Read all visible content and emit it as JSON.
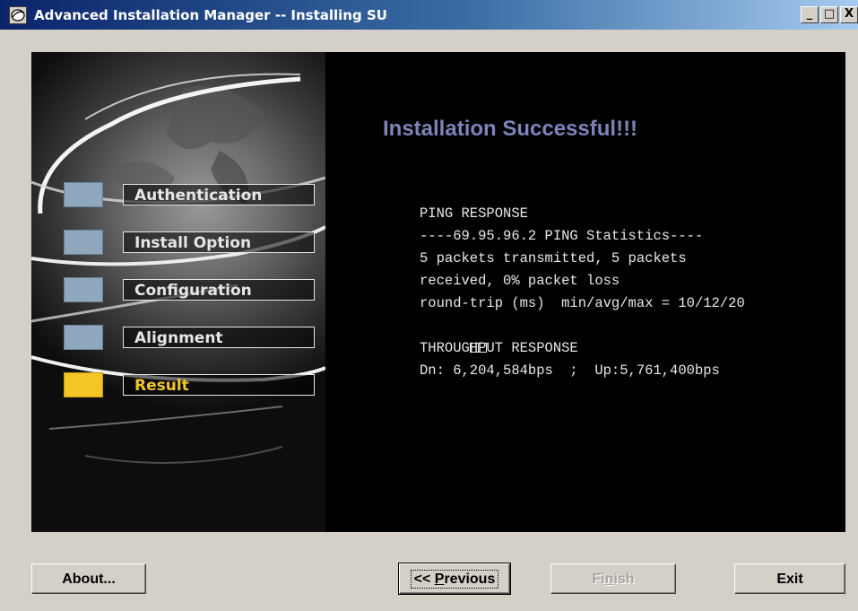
{
  "window": {
    "title": "Advanced Installation Manager -- Installing SU",
    "controls": {
      "minimize": "_",
      "maximize": "□",
      "close": "X"
    }
  },
  "sidebar": {
    "items": [
      {
        "label": "Authentication",
        "active": false
      },
      {
        "label": "Install Option",
        "active": false
      },
      {
        "label": "Configuration",
        "active": false
      },
      {
        "label": "Alignment",
        "active": false
      },
      {
        "label": "Result",
        "active": true
      }
    ],
    "inactive_color": "#8fa8bd",
    "active_color": "#f3c526"
  },
  "content": {
    "heading": "Installation Successful!!!",
    "heading_color": "#7e83b8",
    "lines": [
      "PING RESPONSE",
      "----69.95.96.2 PING Statistics----",
      "5 packets transmitted, 5 packets",
      "received, 0% packet loss",
      "round-trip (ms)  min/avg/max = 10/12/20",
      "THROUGHPUT RESPONSE",
      "Dn: 6,204,584bps  ;  Up:5,761,400bps"
    ]
  },
  "buttons": {
    "about": "About...",
    "previous_prefix": "<< ",
    "previous_underlined": "P",
    "previous_rest": "revious",
    "finish_prefix": "Fi",
    "finish_underlined": "n",
    "finish_rest": "ish",
    "exit": "Exit"
  }
}
